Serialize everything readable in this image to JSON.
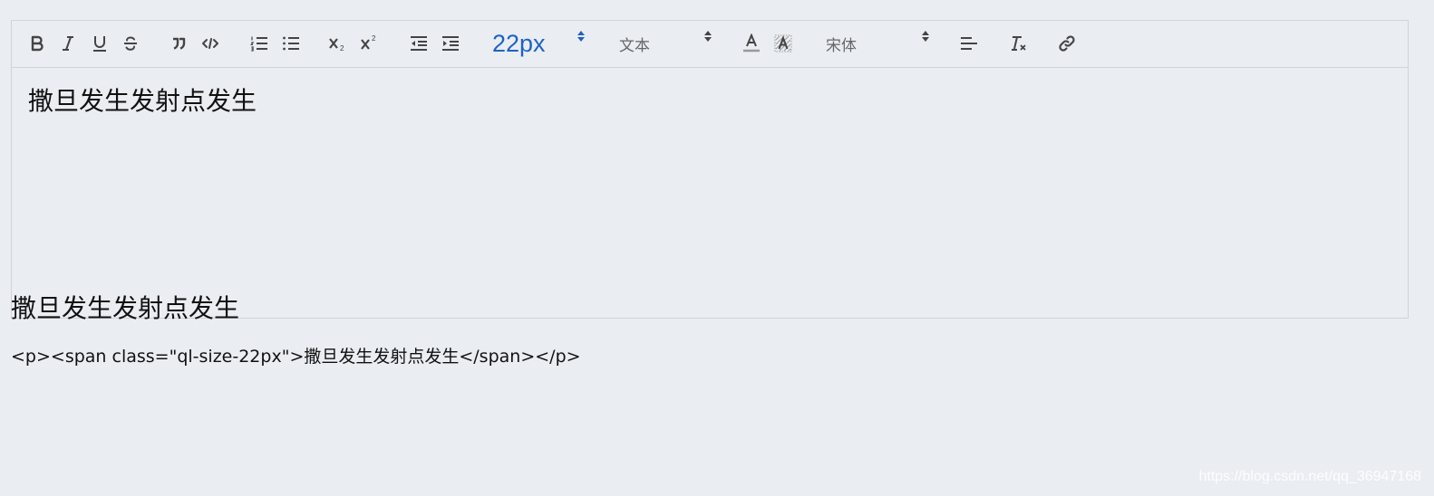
{
  "toolbar": {
    "buttons": [
      {
        "name": "bold",
        "icon": "bold-icon"
      },
      {
        "name": "italic",
        "icon": "italic-icon"
      },
      {
        "name": "underline",
        "icon": "underline-icon"
      },
      {
        "name": "strike",
        "icon": "strikethrough-icon"
      },
      {
        "name": "blockquote",
        "icon": "blockquote-icon"
      },
      {
        "name": "code-block",
        "icon": "code-block-icon"
      },
      {
        "name": "ordered-list",
        "icon": "ordered-list-icon"
      },
      {
        "name": "bullet-list",
        "icon": "bullet-list-icon"
      },
      {
        "name": "subscript",
        "icon": "subscript-icon"
      },
      {
        "name": "superscript",
        "icon": "superscript-icon"
      },
      {
        "name": "indent-decrease",
        "icon": "outdent-icon"
      },
      {
        "name": "indent-increase",
        "icon": "indent-icon"
      },
      {
        "name": "text-color",
        "icon": "font-color-icon"
      },
      {
        "name": "background-color",
        "icon": "background-color-icon"
      },
      {
        "name": "align",
        "icon": "align-left-icon"
      },
      {
        "name": "clean",
        "icon": "clear-format-icon"
      },
      {
        "name": "link",
        "icon": "link-icon"
      }
    ],
    "size_picker": {
      "value": "22px"
    },
    "header_picker": {
      "value": "文本"
    },
    "font_picker": {
      "value": "宋体"
    },
    "accent_color": "#1e62c7"
  },
  "editor": {
    "content": "撒旦发生发射点发生"
  },
  "preview": {
    "rendered_text": "撒旦发生发射点发生",
    "html_output": "<p><span class=\"ql-size-22px\">撒旦发生发射点发生</span></p>"
  },
  "watermark": "https://blog.csdn.net/qq_36947168"
}
